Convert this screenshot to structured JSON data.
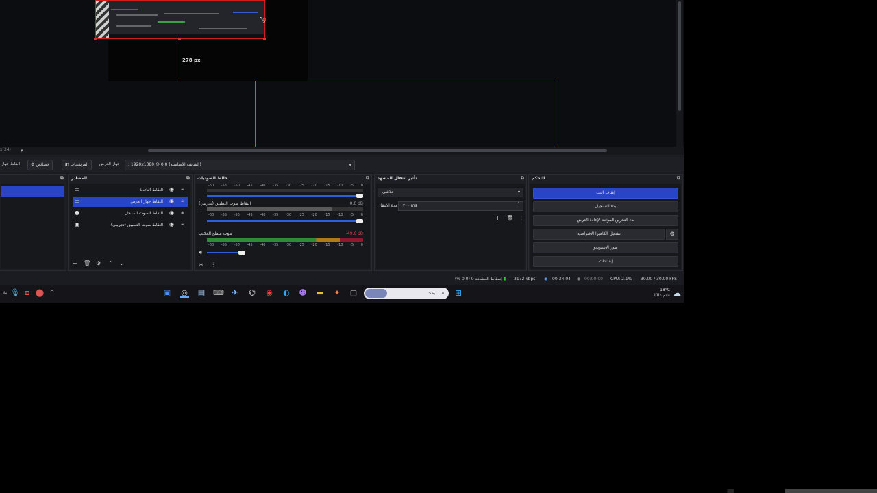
{
  "preview": {
    "zoom_label": "x(34)",
    "px_readout": "278 px"
  },
  "context_bar": {
    "source_props_label": "الفاظ جهاز",
    "properties_label": "خصائص",
    "filters_label": "المرشحات",
    "display_label": "جهاز العرض",
    "display_value": ": 1920x1080 @ 0,0 (الشاشة الأساسية)"
  },
  "docks": {
    "scenes_title": "",
    "sources_title": "المصادر",
    "mixer_title": "خالط الصوتيات",
    "transitions_title": "تأثير انتقال المشهد",
    "controls_title": "التحكم"
  },
  "sources": [
    {
      "label": "التقاط النافذة",
      "icon": "window-icon",
      "selected": false
    },
    {
      "label": "التقاط جهاز العرض",
      "icon": "monitor-icon",
      "selected": true
    },
    {
      "label": "التقاط الصوت المدخل",
      "icon": "mic-icon",
      "selected": false
    },
    {
      "label": "التقاط صوت التطبيق (تجريبي)",
      "icon": "app-audio-icon",
      "selected": false
    }
  ],
  "mixer": {
    "scale": [
      "-60",
      "-55",
      "-50",
      "-45",
      "-40",
      "-35",
      "-30",
      "-25",
      "-20",
      "-15",
      "-10",
      "-5",
      "0"
    ],
    "channels": [
      {
        "name": "",
        "db": ""
      },
      {
        "name": "التقاط صوت التطبيق (تجريبي)",
        "db": "0.0 dB"
      },
      {
        "name": "صوت سطح المكتب",
        "db": "-49.6 dB"
      }
    ]
  },
  "transitions": {
    "selected": "تلاشي",
    "duration_label": "مدة الانتقال",
    "duration_value": "٣٠٠ ms"
  },
  "controls": {
    "buttons": [
      "إيقاف البث",
      "بدء التسجيل",
      "بدء التخزين المؤقت لإعادة العرض",
      "تشغيل الكاميرا الافتراضية",
      "طور الاستوديو",
      "إعدادات"
    ]
  },
  "status": {
    "dropped": "إسقاط المشاهد 0 (0.0 %)",
    "bitrate": "3172 kbps",
    "stream_time": "00:34:04",
    "rec_time": "00:00:00",
    "cpu": "CPU: 2.1%",
    "fps": "30.00 / 30.00 FPS"
  },
  "taskbar": {
    "search_placeholder": "بحث",
    "weather_temp": "18°C",
    "weather_desc": "غائم غالبًا"
  },
  "colors": {
    "accent": "#2745c6",
    "guide_red": "#c81e1e",
    "selection_blue": "#2f86e0"
  }
}
